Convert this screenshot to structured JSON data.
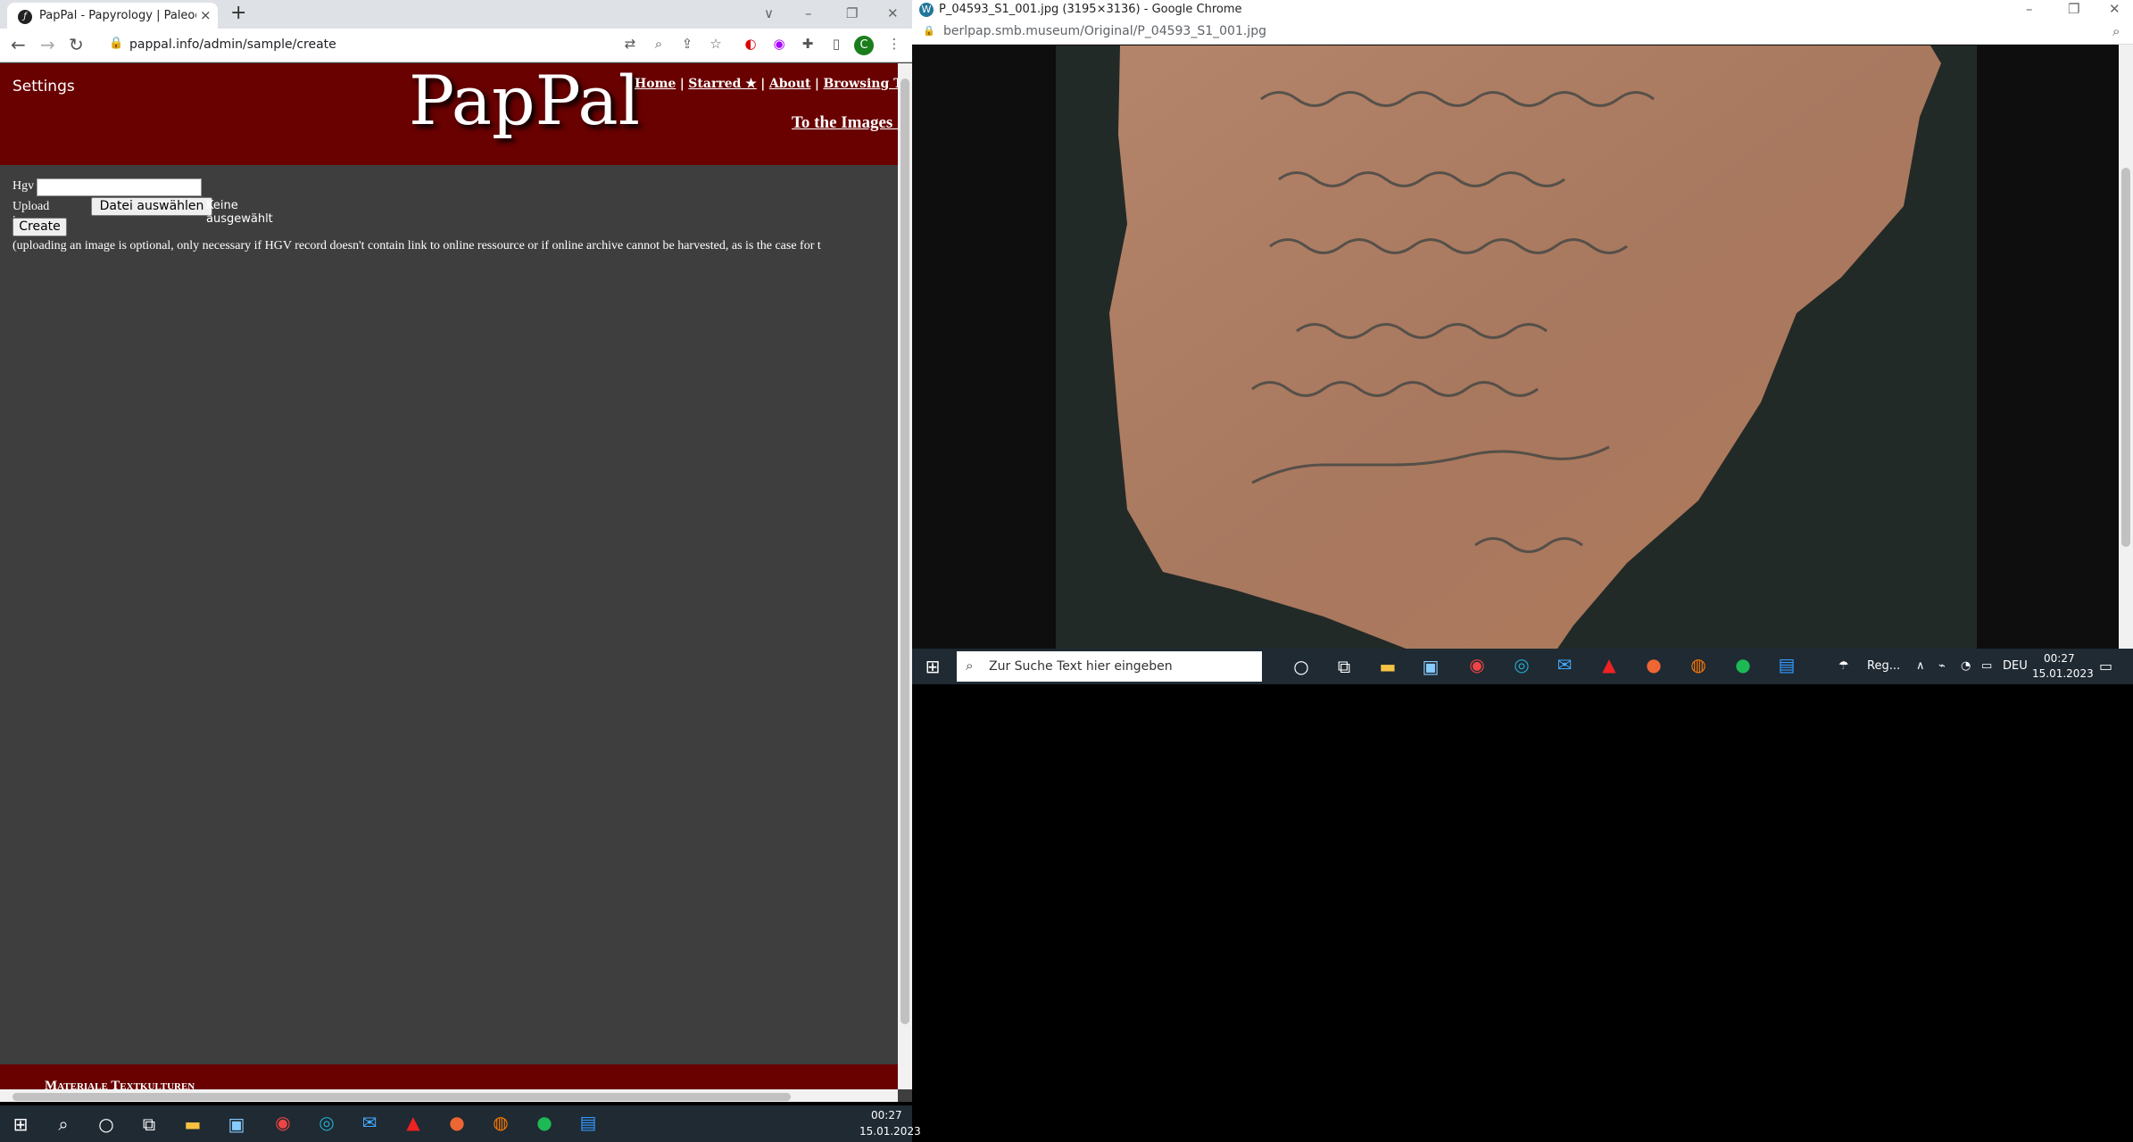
{
  "left_browser": {
    "tab_title": "PapPal - Papyrology | Paleograph",
    "tab_close": "×",
    "new_tab": "+",
    "url": "pappal.info/admin/sample/create",
    "window_controls": {
      "chevron": "∨",
      "minimize": "–",
      "restore": "❐",
      "close": "✕"
    },
    "nav_icons": {
      "back": "←",
      "forward": "→",
      "reload": "↻"
    },
    "profile": "C"
  },
  "page": {
    "settings": "Settings",
    "logo": "PapPal",
    "nav": [
      "Home",
      "Starred ★",
      "About",
      "Browsing Tips"
    ],
    "nav_sep": "|",
    "to_images": "To the Images ...",
    "form": {
      "hgv_label": "Hgv",
      "hgv_value": "",
      "upload_label": "Upload image",
      "file_button": "Datei auswählen",
      "file_status": "Keine ausgewählt",
      "create_button": "Create",
      "note": "(uploading an image is optional, only necessary if HGV record doesn't contain link to online ressource or if online archive cannot be harvested, as is the case for t"
    },
    "footer": "Materiale Textkulturen"
  },
  "right_browser": {
    "title": "P_04593_S1_001.jpg (3195×3136) - Google Chrome",
    "url": "berlpap.smb.museum/Original/P_04593_S1_001.jpg",
    "window_controls": {
      "minimize": "–",
      "restore": "❐",
      "close": "✕"
    },
    "image_alt": "ostracon fragment with Greek script"
  },
  "taskbar_right": {
    "search_placeholder": "Zur Suche Text hier eingeben",
    "weather": "Reg...",
    "lang": "DEU",
    "time": "00:27",
    "date": "15.01.2023"
  },
  "taskbar_left": {
    "time": "00:27",
    "date": "15.01.2023"
  },
  "colors": {
    "header": "#690100",
    "page_bg": "#3e3e3e"
  }
}
